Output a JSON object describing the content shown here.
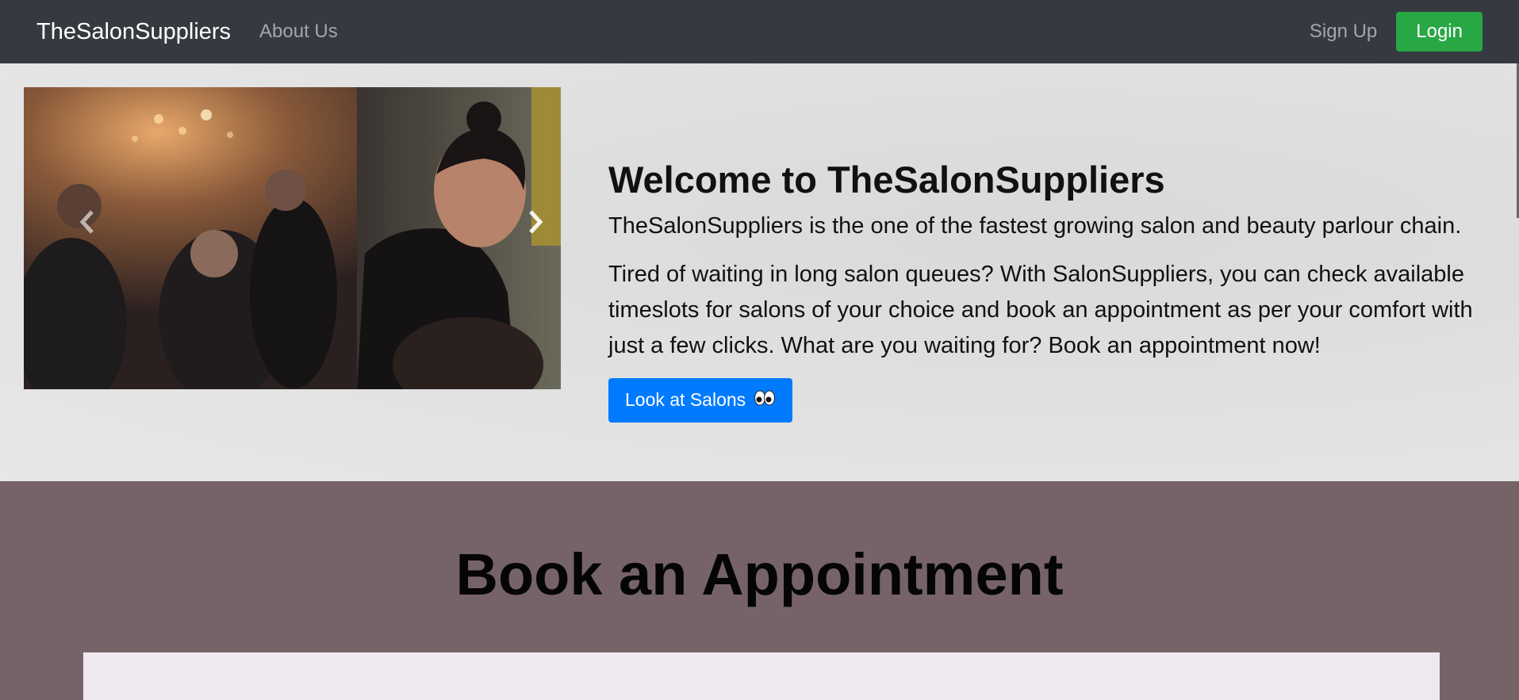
{
  "navbar": {
    "brand": "TheSalonSuppliers",
    "about": "About Us",
    "signup": "Sign Up",
    "login": "Login"
  },
  "hero": {
    "title": "Welcome to TheSalonSuppliers",
    "lead": "TheSalonSuppliers is the one of the fastest growing salon and beauty parlour chain.",
    "description": "Tired of waiting in long salon queues? With SalonSuppliers, you can check available timeslots for salons of your choice and book an appointment as per your comfort with just a few clicks. What are you waiting for? Book an appointment now!",
    "cta": "Look at Salons"
  },
  "book": {
    "title": "Book an Appointment"
  },
  "icons": {
    "prev": "chevron-left-icon",
    "next": "chevron-right-icon",
    "eyes": "eyes-icon"
  },
  "colors": {
    "navbar_bg": "#343a40",
    "login_btn": "#28a745",
    "cta_btn": "#007bff",
    "book_section_bg": "#766368",
    "book_card_bg": "#efe8ef"
  }
}
